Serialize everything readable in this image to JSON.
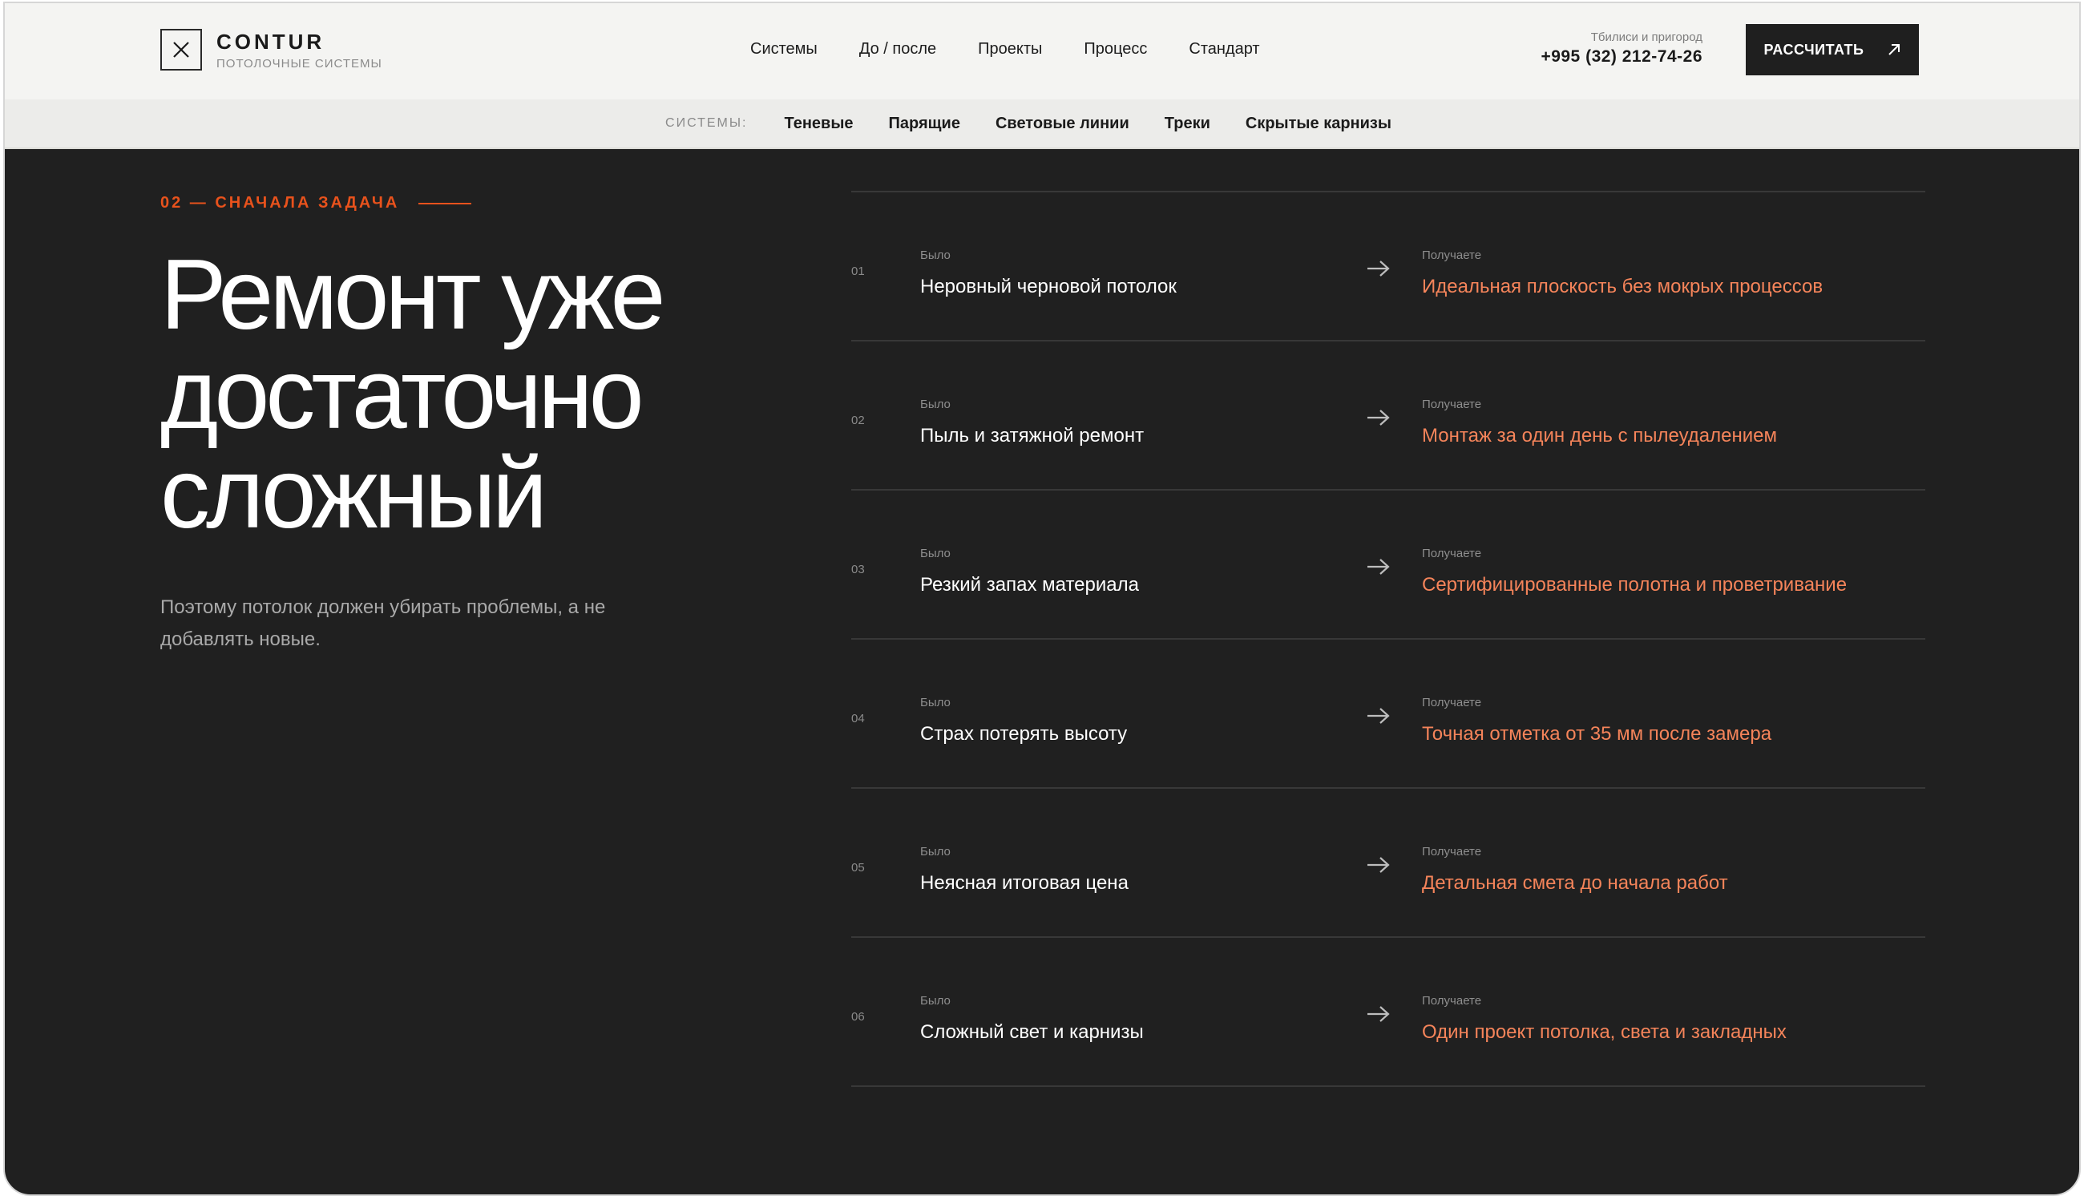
{
  "header": {
    "brand": "CONTUR",
    "tagline": "ПОТОЛОЧНЫЕ СИСТЕМЫ",
    "nav": [
      "Системы",
      "До / после",
      "Проекты",
      "Процесс",
      "Стандарт"
    ],
    "city": "Тбилиси и пригород",
    "phone": "+995 (32) 212-74-26",
    "cta_label": "РАССЧИТАТЬ"
  },
  "subnav": {
    "label": "СИСТЕМЫ:",
    "items": [
      "Теневые",
      "Парящие",
      "Световые линии",
      "Треки",
      "Скрытые карнизы"
    ]
  },
  "section": {
    "eyebrow": "02 — СНАЧАЛА ЗАДАЧА",
    "title_lines": [
      "Ремонт уже",
      "достаточно",
      "сложный"
    ],
    "lead": "Поэтому потолок должен убирать проблемы, а не добавлять новые.",
    "was_label": "Было",
    "get_label": "Получаете",
    "rows": [
      {
        "num": "01",
        "was": "Неровный черновой потолок",
        "get": "Идеальная плоскость без мокрых процессов"
      },
      {
        "num": "02",
        "was": "Пыль и затяжной ремонт",
        "get": "Монтаж за один день с пылеудалением"
      },
      {
        "num": "03",
        "was": "Резкий запах материала",
        "get": "Сертифицированные полотна и проветривание"
      },
      {
        "num": "04",
        "was": "Страх потерять высоту",
        "get": "Точная отметка от 35 мм после замера"
      },
      {
        "num": "05",
        "was": "Неясная итоговая цена",
        "get": "Детальная смета до начала работ"
      },
      {
        "num": "06",
        "was": "Сложный свет и карнизы",
        "get": "Один проект потолка, света и закладных"
      }
    ]
  },
  "colors": {
    "accent": "#e8521c",
    "accent_text": "#f5845a",
    "background": "#202020",
    "header_bg": "#f4f4f2"
  },
  "icons": {
    "logo": "close-x-icon",
    "cta": "arrow-up-right-icon",
    "row": "arrow-right-icon"
  }
}
